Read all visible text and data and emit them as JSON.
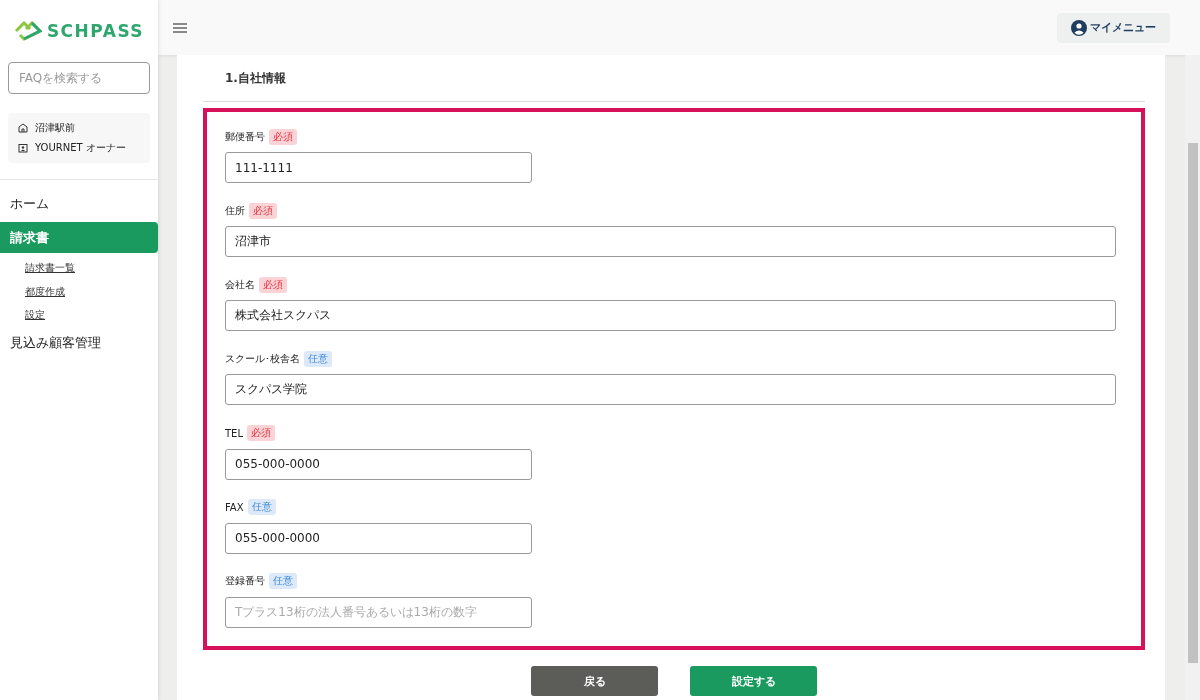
{
  "logo": {
    "text": "SCHPASS"
  },
  "sidebar": {
    "search": {
      "placeholder": "FAQを検索する"
    },
    "account": [
      {
        "kind": "school",
        "text": "沼津駅前"
      },
      {
        "kind": "user",
        "text": "YOURNET オーナー"
      }
    ],
    "items": [
      {
        "label": "ホーム",
        "selected": false
      },
      {
        "label": "請求書",
        "selected": true,
        "children": [
          {
            "label": "請求書一覧"
          },
          {
            "label": "都度作成"
          },
          {
            "label": "設定"
          }
        ]
      },
      {
        "label": "見込み顧客管理",
        "selected": false
      }
    ]
  },
  "header": {
    "menu_button": "マイメニュー"
  },
  "section": {
    "title": "1.自社情報"
  },
  "fields": [
    {
      "label": "郵便番号",
      "badge": "必須",
      "required": true,
      "wide": false,
      "value": "111-1111"
    },
    {
      "label": "住所",
      "badge": "必須",
      "required": true,
      "wide": true,
      "value": "沼津市"
    },
    {
      "label": "会社名",
      "badge": "必須",
      "required": true,
      "wide": true,
      "value": "株式会社スクパス"
    },
    {
      "label": "スクール･校舎名",
      "badge": "任意",
      "required": false,
      "wide": true,
      "value": "スクパス学院"
    },
    {
      "label": "TEL",
      "badge": "必須",
      "required": true,
      "wide": false,
      "value": "055-000-0000"
    },
    {
      "label": "FAX",
      "badge": "任意",
      "required": false,
      "wide": false,
      "value": "055-000-0000"
    },
    {
      "label": "登録番号",
      "badge": "任意",
      "required": false,
      "wide": false,
      "placeholder": "Tプラス13桁の法人番号あるいは13桁の数字"
    }
  ],
  "buttons": [
    {
      "kind": "back",
      "label": "戻る"
    },
    {
      "kind": "submit",
      "label": "設定する"
    }
  ]
}
